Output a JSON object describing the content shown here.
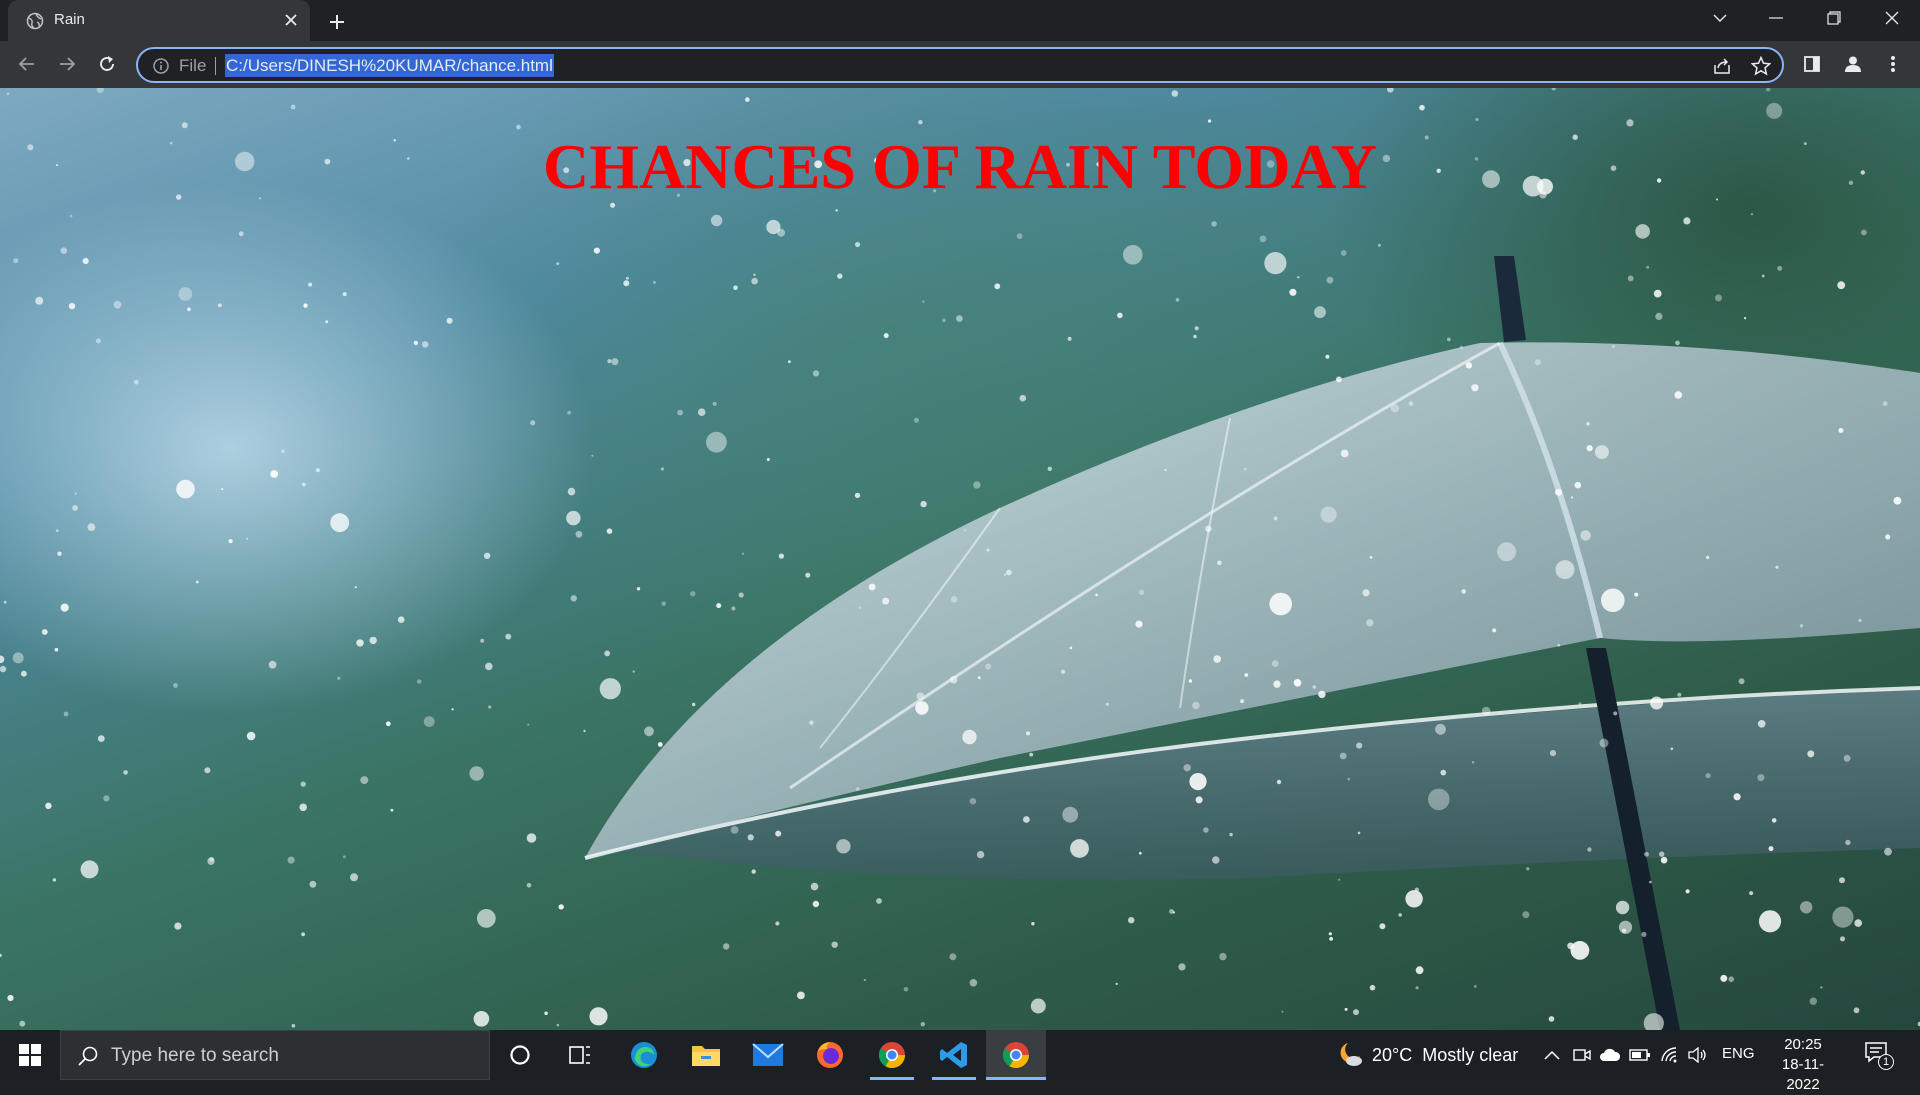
{
  "browser": {
    "tab_title": "Rain",
    "url_scheme": "File",
    "url": "C:/Users/DINESH%20KUMAR/chance.html"
  },
  "page": {
    "headline": "CHANCES OF RAIN TODAY",
    "headline_color": "#ff0000"
  },
  "taskbar": {
    "search_placeholder": "Type here to search",
    "apps": [
      "task-view",
      "edge",
      "file-explorer",
      "mail",
      "firefox",
      "chrome",
      "vscode",
      "chrome-active"
    ],
    "weather_temp": "20°C",
    "weather_condition": "Mostly clear",
    "language": "ENG",
    "time": "20:25",
    "date": "18-11-2022",
    "notification_count": "1"
  },
  "colors": {
    "chrome_dark": "#202124",
    "toolbar": "#35363a",
    "omnibox_border": "#8ab4f8",
    "url_selection": "#3367d6",
    "taskbar": "#1c1f24"
  }
}
